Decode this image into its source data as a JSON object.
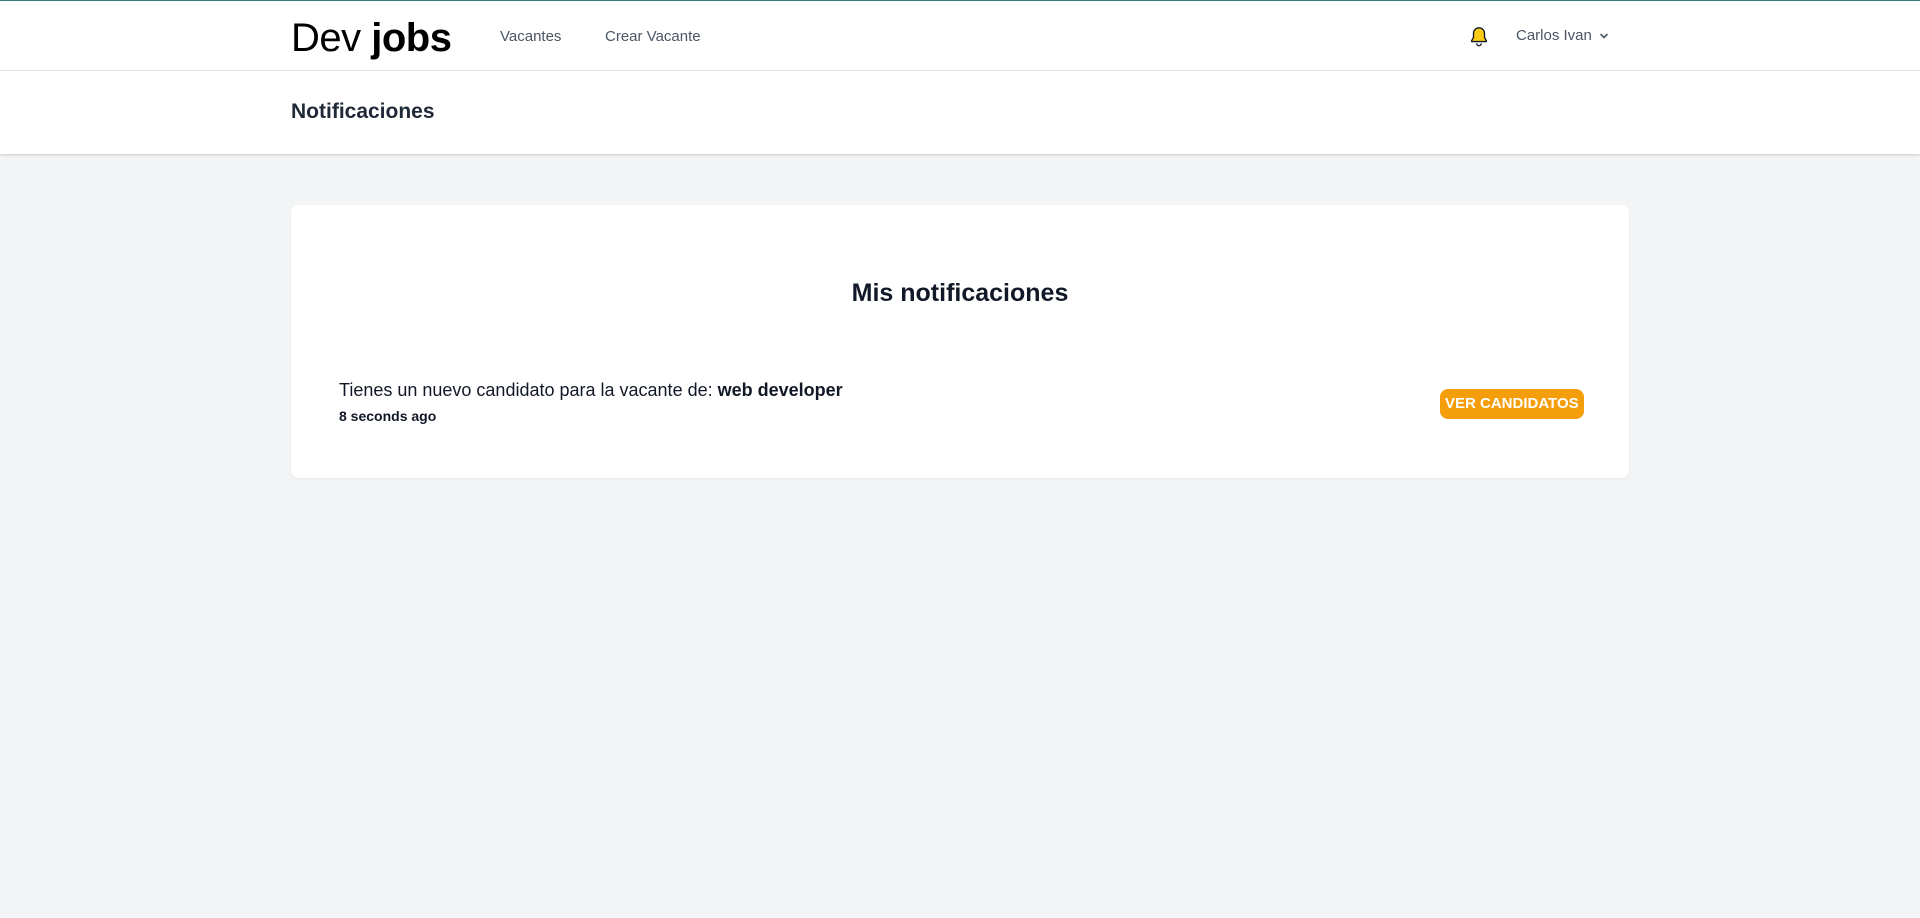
{
  "logo": {
    "part1": "Dev",
    "part2": "jobs"
  },
  "nav": {
    "links": [
      {
        "label": "Vacantes"
      },
      {
        "label": "Crear Vacante"
      }
    ]
  },
  "user": {
    "name": "Carlos Ivan"
  },
  "header": {
    "title": "Notificaciones"
  },
  "card": {
    "title": "Mis notificaciones"
  },
  "notification": {
    "text": "Tienes un nuevo candidato para la vacante de:",
    "job": "web developer",
    "time": "8 seconds ago",
    "button_label": "VER CANDIDATOS"
  },
  "colors": {
    "accent": "#f59e0b",
    "bell": "#facc15",
    "top_line": "#2f7f7f",
    "background": "#f3f4f6"
  },
  "icons": {
    "bell": "bell-icon",
    "dropdown": "chevron-down-icon"
  }
}
